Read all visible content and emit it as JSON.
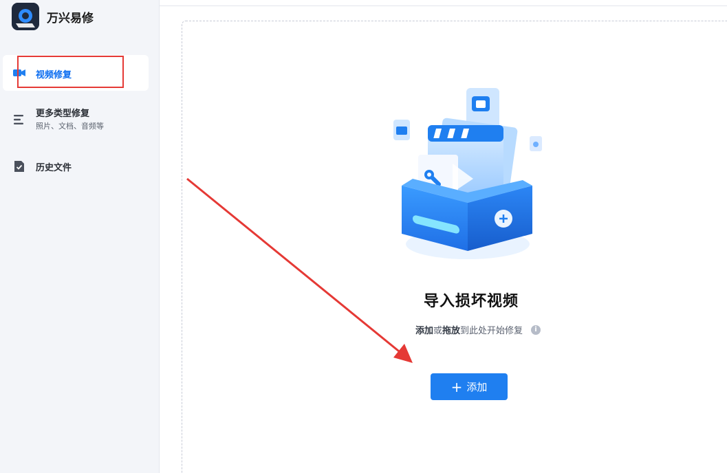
{
  "app": {
    "title": "万兴易修"
  },
  "sidebar": {
    "items": [
      {
        "label": "视频修复"
      },
      {
        "label": "更多类型修复",
        "sublabel": "照片、文档、音频等"
      },
      {
        "label": "历史文件"
      }
    ]
  },
  "main": {
    "title": "导入损坏视频",
    "hint": {
      "add": "添加",
      "or": "或",
      "drag": "拖放",
      "rest": "到此处开始修复"
    },
    "info_icon": "i",
    "add_button": {
      "plus": "+",
      "label": "添加"
    }
  },
  "colors": {
    "accent": "#1f7ff0",
    "annotation": "#e53935"
  }
}
